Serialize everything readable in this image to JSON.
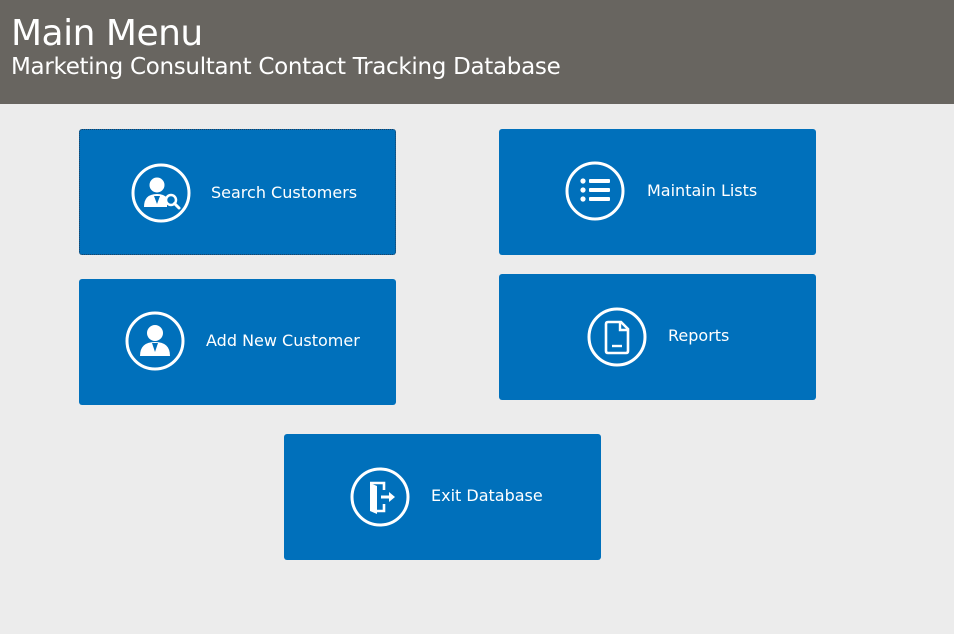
{
  "header": {
    "title": "Main Menu",
    "subtitle": "Marketing Consultant Contact Tracking Database",
    "background": "#686560"
  },
  "tiles": {
    "search_customers": {
      "label": "Search Customers",
      "icon": "user-search-icon"
    },
    "maintain_lists": {
      "label": "Maintain Lists",
      "icon": "list-icon"
    },
    "add_new_customer": {
      "label": "Add New Customer",
      "icon": "user-icon"
    },
    "reports": {
      "label": "Reports",
      "icon": "document-icon"
    },
    "exit_database": {
      "label": "Exit Database",
      "icon": "exit-door-icon"
    }
  },
  "colors": {
    "tile": "#0070bb",
    "page_background": "#ececec"
  }
}
